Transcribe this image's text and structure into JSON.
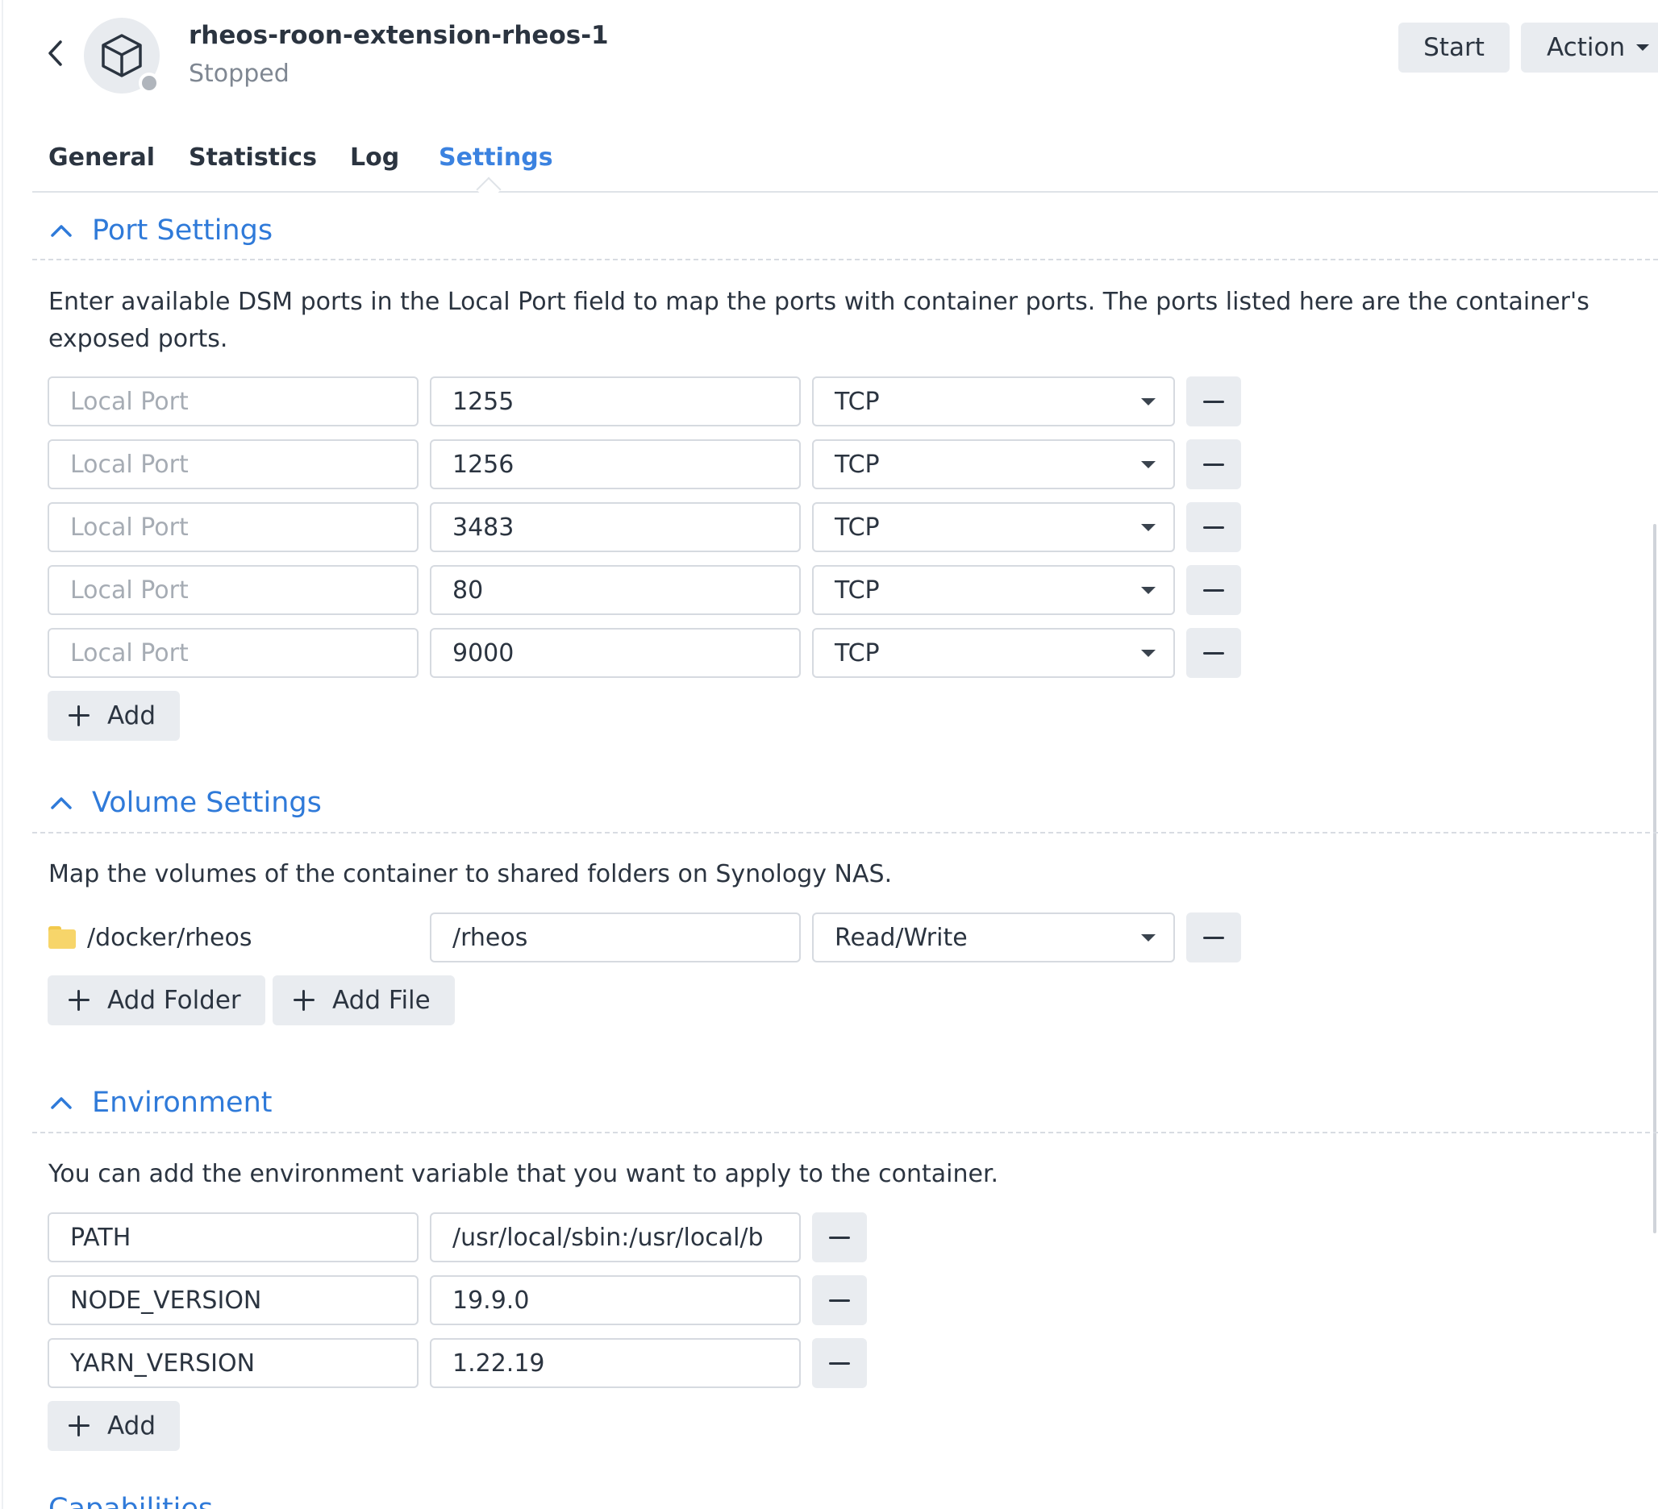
{
  "header": {
    "title": "rheos-roon-extension-rheos-1",
    "status": "Stopped",
    "start_label": "Start",
    "action_label": "Action"
  },
  "tabs": [
    {
      "label": "General",
      "active": false
    },
    {
      "label": "Statistics",
      "active": false
    },
    {
      "label": "Log",
      "active": false
    },
    {
      "label": "Settings",
      "active": true
    }
  ],
  "port_settings": {
    "title": "Port Settings",
    "description": "Enter available DSM ports in the Local Port field to map the ports with container ports. The ports listed here are the container's exposed ports.",
    "local_placeholder": "Local Port",
    "rows": [
      {
        "container_port": "1255",
        "protocol": "TCP"
      },
      {
        "container_port": "1256",
        "protocol": "TCP"
      },
      {
        "container_port": "3483",
        "protocol": "TCP"
      },
      {
        "container_port": "80",
        "protocol": "TCP"
      },
      {
        "container_port": "9000",
        "protocol": "TCP"
      }
    ],
    "add_label": "Add"
  },
  "volume_settings": {
    "title": "Volume Settings",
    "description": "Map the volumes of the container to shared folders on Synology NAS.",
    "rows": [
      {
        "folder": "/docker/rheos",
        "mount_path": "/rheos",
        "mode": "Read/Write"
      }
    ],
    "add_folder_label": "Add Folder",
    "add_file_label": "Add File"
  },
  "environment": {
    "title": "Environment",
    "description": "You can add the environment variable that you want to apply to the container.",
    "rows": [
      {
        "key": "PATH",
        "value": "/usr/local/sbin:/usr/local/b"
      },
      {
        "key": "NODE_VERSION",
        "value": "19.9.0"
      },
      {
        "key": "YARN_VERSION",
        "value": "1.22.19"
      }
    ],
    "add_label": "Add"
  },
  "next_section_peek": "Capabilities",
  "colors": {
    "accent": "#3b82e0",
    "section_title": "#2f7ad9",
    "button_bg": "#e9ecf0",
    "status_dot": "#b0b5bc",
    "folder": "#f7d56a"
  },
  "icons": {
    "back": "chevron-left-icon",
    "container": "cube-icon",
    "collapse": "chevron-up-icon",
    "remove": "minus-icon",
    "add": "plus-icon",
    "folder": "folder-icon",
    "dropdown": "caret-down-icon"
  }
}
